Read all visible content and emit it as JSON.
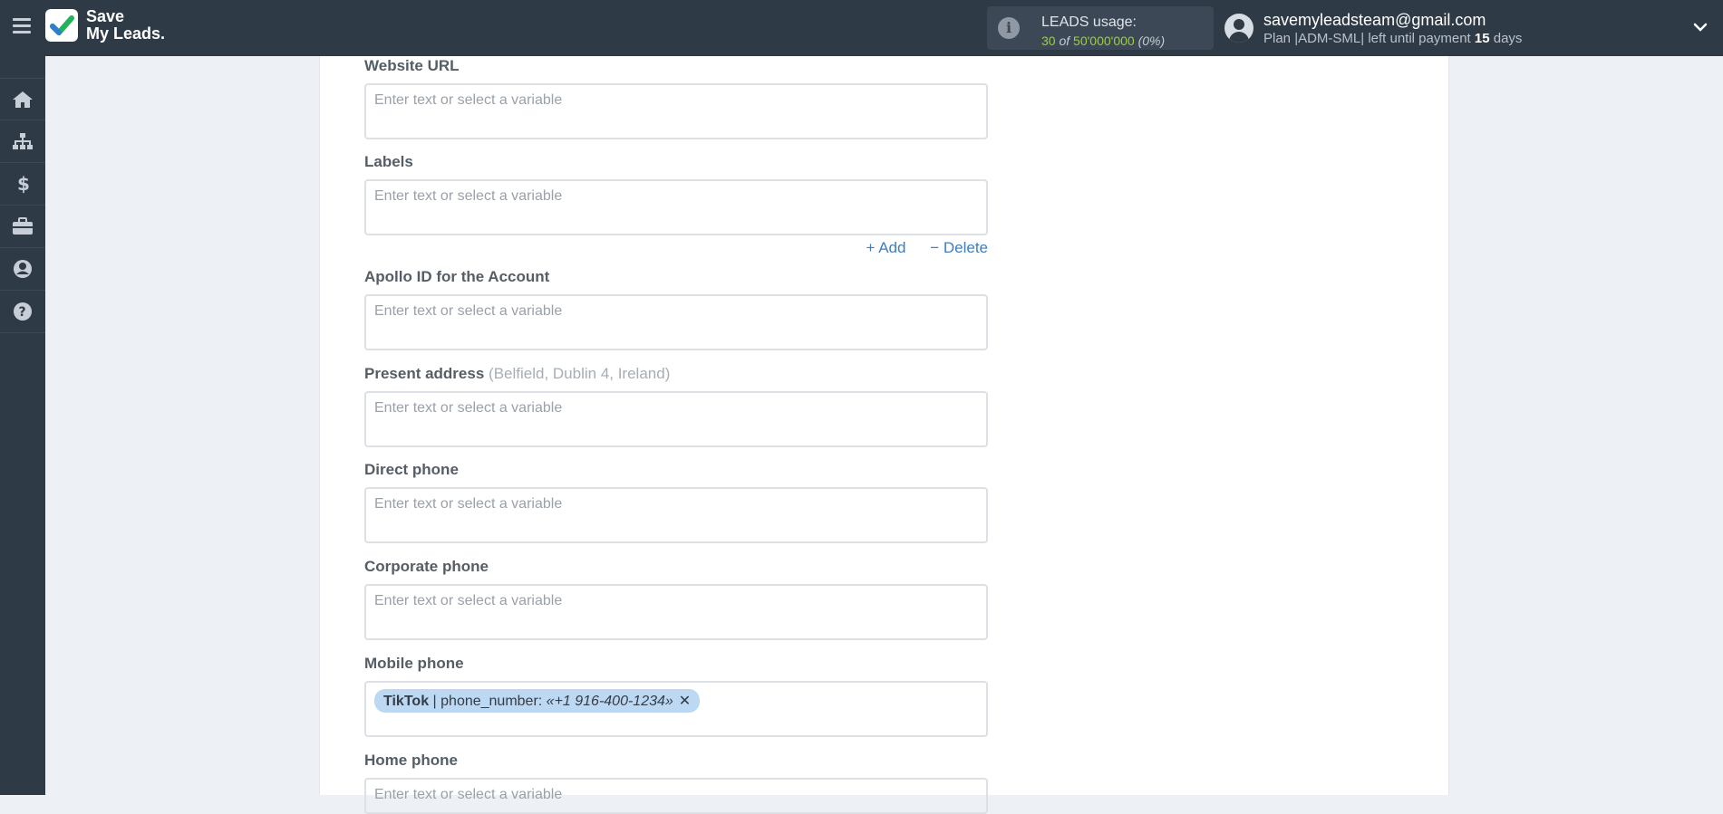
{
  "brand": {
    "name_line1": "Save",
    "name_line2": "My Leads."
  },
  "usage": {
    "label": "LEADS usage:",
    "used": "30",
    "of": "of",
    "total": "50'000'000",
    "percent": "(0%)"
  },
  "user": {
    "email": "savemyleadsteam@gmail.com",
    "plan_prefix": "Plan |ADM-SML| left until payment",
    "days": "15",
    "days_suffix": "days"
  },
  "sidebar": {
    "items": [
      "home-icon",
      "sitemap-icon",
      "dollar-icon",
      "briefcase-icon",
      "user-icon",
      "help-icon"
    ]
  },
  "form": {
    "placeholder": "Enter text or select a variable",
    "website_url": {
      "label": "Website URL"
    },
    "labels": {
      "label": "Labels",
      "add": "+ Add",
      "delete": "− Delete"
    },
    "apollo_id": {
      "label": "Apollo ID for the Account"
    },
    "present_address": {
      "label": "Present address",
      "hint": "(Belfield, Dublin 4, Ireland)"
    },
    "direct_phone": {
      "label": "Direct phone"
    },
    "corporate_phone": {
      "label": "Corporate phone"
    },
    "mobile_phone": {
      "label": "Mobile phone",
      "tag_source": "TikTok",
      "tag_field": " | phone_number: ",
      "tag_value": "«+1 916-400-1234»",
      "tag_remove": "✕"
    },
    "home_phone": {
      "label": "Home phone"
    }
  },
  "colors": {
    "topbar": "#2f3a47",
    "accent_link": "#3c7ebf",
    "usage_green": "#9ccf3f",
    "tag_bg": "#bcd8f3"
  }
}
